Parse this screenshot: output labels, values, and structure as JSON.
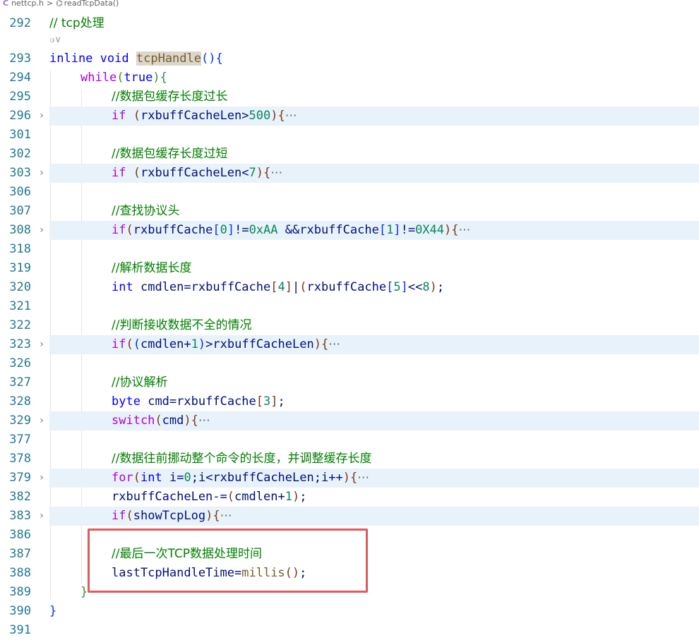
{
  "breadcrumb": {
    "file": "nettcp.h",
    "separator": ">",
    "symbol": "readTcpData()"
  },
  "codelens": "ဖ∨",
  "lines": [
    {
      "n": "292",
      "comment": "// tcp处理"
    },
    {
      "n": "293"
    },
    {
      "n": "294"
    },
    {
      "n": "295",
      "comment": "//数据包缓存长度过长"
    },
    {
      "n": "296"
    },
    {
      "n": "301"
    },
    {
      "n": "302",
      "comment": "//数据包缓存长度过短"
    },
    {
      "n": "303"
    },
    {
      "n": "306"
    },
    {
      "n": "307",
      "comment": "//查找协议头"
    },
    {
      "n": "308"
    },
    {
      "n": "318"
    },
    {
      "n": "319",
      "comment": "//解析数据长度"
    },
    {
      "n": "320"
    },
    {
      "n": "321"
    },
    {
      "n": "322",
      "comment": "//判断接收数据不全的情况"
    },
    {
      "n": "323"
    },
    {
      "n": "326"
    },
    {
      "n": "327",
      "comment": "//协议解析"
    },
    {
      "n": "328"
    },
    {
      "n": "329"
    },
    {
      "n": "377"
    },
    {
      "n": "378",
      "comment": "//数据往前挪动整个命令的长度，并调整缓存长度"
    },
    {
      "n": "379"
    },
    {
      "n": "382"
    },
    {
      "n": "383"
    },
    {
      "n": "386"
    },
    {
      "n": "387",
      "comment": "//最后一次TCP数据处理时间"
    },
    {
      "n": "388"
    },
    {
      "n": "389"
    },
    {
      "n": "390"
    },
    {
      "n": "391"
    }
  ],
  "tokens": {
    "inline": "inline",
    "void": "void",
    "tcpHandle": "tcpHandle",
    "while": "while",
    "true": "true",
    "if": "if",
    "int": "int",
    "byte": "byte",
    "switch": "switch",
    "for": "for",
    "rxbuffCacheLen": "rxbuffCacheLen",
    "rxbuffCache": "rxbuffCache",
    "n500": "500",
    "n7": "7",
    "n0": "0",
    "n1": "1",
    "n4": "4",
    "n5": "5",
    "n8": "8",
    "n3": "3",
    "hexAA": "0xAA",
    "hex44": "0X44",
    "cmdlen": "cmdlen",
    "cmd": "cmd",
    "i": "i",
    "showTcpLog": "showTcpLog",
    "lastTcpHandleTime": "lastTcpHandleTime",
    "millis": "millis",
    "ellipsis": "⋯"
  },
  "chevron": "›",
  "colors": {
    "keyword": "#0000ff",
    "control": "#af00db",
    "number": "#098658",
    "comment": "#008000",
    "function": "#795e26",
    "variable": "#001080",
    "line_number": "#237893",
    "folded_bg": "#e8f2fb",
    "highlight_box": "#e05a5a"
  }
}
